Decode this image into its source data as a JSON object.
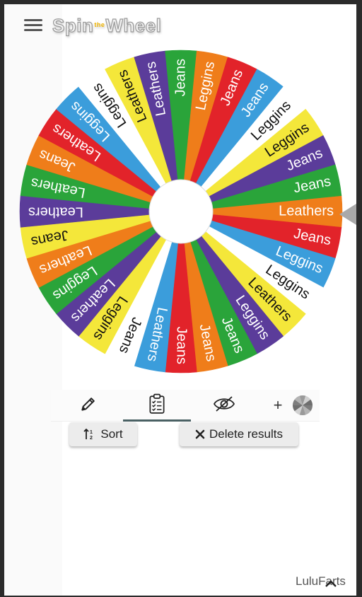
{
  "app": {
    "title_left": "Spin",
    "title_the": "the",
    "title_right": "Wheel"
  },
  "wheel": {
    "colors": {
      "red": "#e2232a",
      "blue": "#3b9ddb",
      "white": "#ffffff",
      "yellow": "#f4e73a",
      "purple": "#5b3c9a",
      "green": "#2aa43a",
      "orange": "#ef7d1a"
    },
    "pointer_color": "#a9a9a9",
    "segments": [
      {
        "label": "Leathers",
        "color": "orange"
      },
      {
        "label": "Jeans",
        "color": "red"
      },
      {
        "label": "Leggins",
        "color": "blue"
      },
      {
        "label": "Leggins",
        "color": "white"
      },
      {
        "label": "Leathers",
        "color": "yellow"
      },
      {
        "label": "Leggins",
        "color": "purple"
      },
      {
        "label": "Jeans",
        "color": "green"
      },
      {
        "label": "Jeans",
        "color": "orange"
      },
      {
        "label": "Jeans",
        "color": "red"
      },
      {
        "label": "Leathers",
        "color": "blue"
      },
      {
        "label": "Jeans",
        "color": "white"
      },
      {
        "label": "Leggins",
        "color": "yellow"
      },
      {
        "label": "Leathers",
        "color": "purple"
      },
      {
        "label": "Leggins",
        "color": "green"
      },
      {
        "label": "Leathers",
        "color": "orange"
      },
      {
        "label": "Jeans",
        "color": "yellow"
      },
      {
        "label": "Leathers",
        "color": "purple"
      },
      {
        "label": "Leathers",
        "color": "green"
      },
      {
        "label": "Jeans",
        "color": "orange"
      },
      {
        "label": "Leathers",
        "color": "red"
      },
      {
        "label": "Leggins",
        "color": "blue"
      },
      {
        "label": "Leggins",
        "color": "white"
      },
      {
        "label": "Leathers",
        "color": "yellow"
      },
      {
        "label": "Leathers",
        "color": "purple"
      },
      {
        "label": "Jeans",
        "color": "green"
      },
      {
        "label": "Leggins",
        "color": "orange"
      },
      {
        "label": "Jeans",
        "color": "red"
      },
      {
        "label": "Jeans",
        "color": "blue"
      },
      {
        "label": "Leggins",
        "color": "white"
      },
      {
        "label": "Leggins",
        "color": "yellow"
      },
      {
        "label": "Jeans",
        "color": "purple"
      },
      {
        "label": "Jeans",
        "color": "green"
      }
    ]
  },
  "toolbar": {
    "tabs": [
      {
        "icon": "pencil-icon"
      },
      {
        "icon": "clipboard-list-icon",
        "active": true
      },
      {
        "icon": "eye-off-icon"
      }
    ],
    "add_label": "+"
  },
  "actions": {
    "sort_label": "Sort",
    "delete_label": "Delete results"
  },
  "watermark": "LuluFarts"
}
